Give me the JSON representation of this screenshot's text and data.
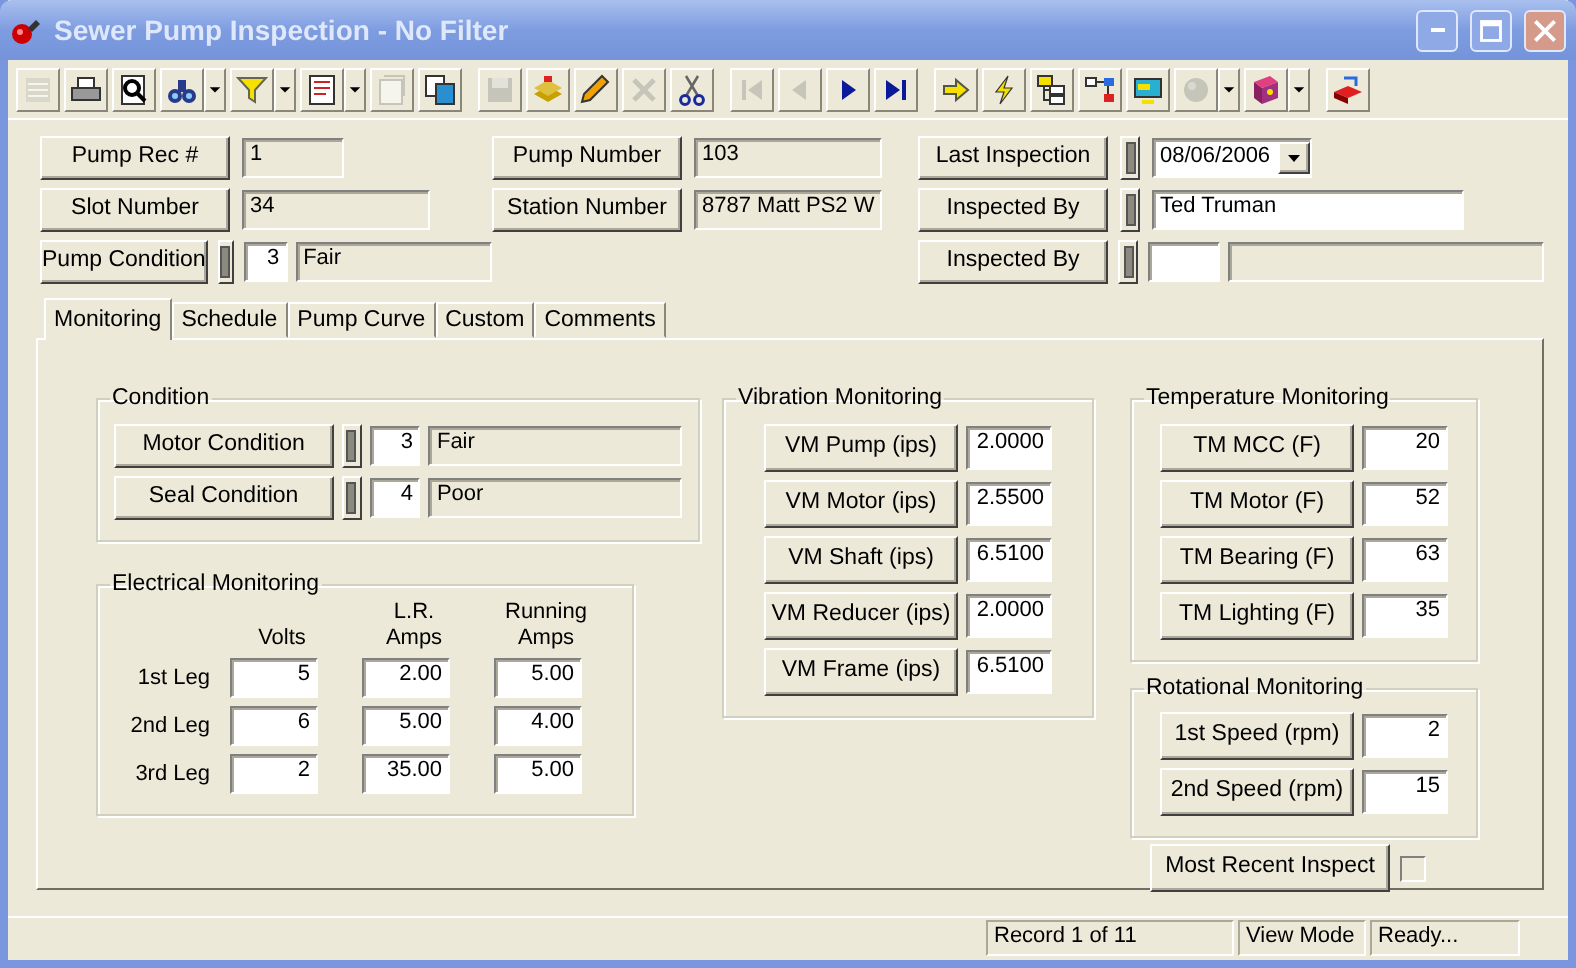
{
  "window": {
    "title": "Sewer Pump Inspection - No Filter"
  },
  "toolbar": [
    [
      {
        "kind": "form",
        "disabled": true,
        "dropdown": false
      },
      {
        "kind": "printer",
        "disabled": false,
        "dropdown": false
      },
      {
        "kind": "preview",
        "disabled": false,
        "dropdown": false
      },
      {
        "kind": "binoculars",
        "disabled": false,
        "dropdown": true
      },
      {
        "kind": "filter",
        "disabled": false,
        "dropdown": true
      },
      {
        "kind": "report",
        "disabled": false,
        "dropdown": true
      },
      {
        "kind": "page",
        "disabled": true,
        "dropdown": false
      },
      {
        "kind": "copy",
        "disabled": false,
        "dropdown": false
      }
    ],
    [
      {
        "kind": "save",
        "disabled": true,
        "dropdown": false
      },
      {
        "kind": "stack",
        "disabled": false,
        "dropdown": false
      },
      {
        "kind": "pencil",
        "disabled": false,
        "dropdown": false
      },
      {
        "kind": "delete",
        "disabled": true,
        "dropdown": false
      },
      {
        "kind": "scissors",
        "disabled": false,
        "dropdown": false
      }
    ],
    [
      {
        "kind": "first",
        "disabled": true,
        "dropdown": false
      },
      {
        "kind": "previous",
        "disabled": true,
        "dropdown": false
      },
      {
        "kind": "next",
        "disabled": false,
        "dropdown": false
      },
      {
        "kind": "last",
        "disabled": false,
        "dropdown": false
      }
    ],
    [
      {
        "kind": "arrow",
        "disabled": false,
        "dropdown": false
      },
      {
        "kind": "lightning",
        "disabled": false,
        "dropdown": false
      },
      {
        "kind": "tree",
        "disabled": false,
        "dropdown": false
      },
      {
        "kind": "flowchart",
        "disabled": false,
        "dropdown": false
      },
      {
        "kind": "monitor",
        "disabled": false,
        "dropdown": false
      },
      {
        "kind": "globe",
        "disabled": true,
        "dropdown": true
      },
      {
        "kind": "book",
        "disabled": false,
        "dropdown": true
      }
    ],
    [
      {
        "kind": "exit",
        "disabled": false,
        "dropdown": false
      }
    ]
  ],
  "header": [
    [
      {
        "kind": "text",
        "label": "Pump Rec #",
        "value": "1"
      },
      {
        "kind": "text",
        "label": "Slot Number",
        "value": "34"
      },
      {
        "kind": "coded",
        "label": "Pump Condition",
        "code": "3",
        "description": "Fair"
      }
    ],
    [
      {
        "kind": "text",
        "label": "Pump Number",
        "value": "103"
      },
      {
        "kind": "text",
        "label": "Station Number",
        "value": "8787 Matt PS2 W"
      }
    ],
    [
      {
        "kind": "date",
        "label": "Last Inspection",
        "value": "08/06/2006"
      },
      {
        "kind": "person",
        "label": "Inspected By",
        "value": "Ted Truman"
      },
      {
        "kind": "coded",
        "label": "Inspected By"
      }
    ]
  ],
  "tabs": [
    {
      "label": "Monitoring",
      "selected": true
    },
    {
      "label": "Schedule",
      "selected": false
    },
    {
      "label": "Pump Curve",
      "selected": false
    },
    {
      "label": "Custom",
      "selected": false
    },
    {
      "label": "Comments",
      "selected": false
    }
  ],
  "condition": {
    "title": "Condition",
    "rows": [
      {
        "label": "Motor Condition",
        "code": "3",
        "description": "Fair"
      },
      {
        "label": "Seal Condition",
        "code": "4",
        "description": "Poor"
      }
    ]
  },
  "electrical": {
    "title": "Electrical Monitoring",
    "columns": [
      "Volts",
      "L.R. Amps",
      "Running Amps"
    ],
    "rows": [
      {
        "label": "1st Leg",
        "values": [
          "5",
          "2.00",
          "5.00"
        ]
      },
      {
        "label": "2nd Leg",
        "values": [
          "6",
          "5.00",
          "4.00"
        ]
      },
      {
        "label": "3rd Leg",
        "values": [
          "2",
          "35.00",
          "5.00"
        ]
      }
    ]
  },
  "vibration": {
    "title": "Vibration Monitoring",
    "rows": [
      {
        "label": "VM Pump (ips)",
        "value": "2.0000"
      },
      {
        "label": "VM Motor (ips)",
        "value": "2.5500"
      },
      {
        "label": "VM Shaft (ips)",
        "value": "6.5100"
      },
      {
        "label": "VM Reducer (ips)",
        "value": "2.0000"
      },
      {
        "label": "VM Frame (ips)",
        "value": "6.5100"
      }
    ]
  },
  "temperature": {
    "title": "Temperature Monitoring",
    "rows": [
      {
        "label": "TM MCC (F)",
        "value": "20"
      },
      {
        "label": "TM Motor (F)",
        "value": "52"
      },
      {
        "label": "TM Bearing (F)",
        "value": "63"
      },
      {
        "label": "TM Lighting (F)",
        "value": "35"
      }
    ]
  },
  "rotational": {
    "title": "Rotational Monitoring",
    "rows": [
      {
        "label": "1st Speed (rpm)",
        "value": "2"
      },
      {
        "label": "2nd Speed (rpm)",
        "value": "15"
      }
    ]
  },
  "most_recent": {
    "label": "Most Recent Inspect",
    "checked": false
  },
  "status_bar": [
    "Record 1 of 11",
    "View Mode",
    "Ready..."
  ]
}
